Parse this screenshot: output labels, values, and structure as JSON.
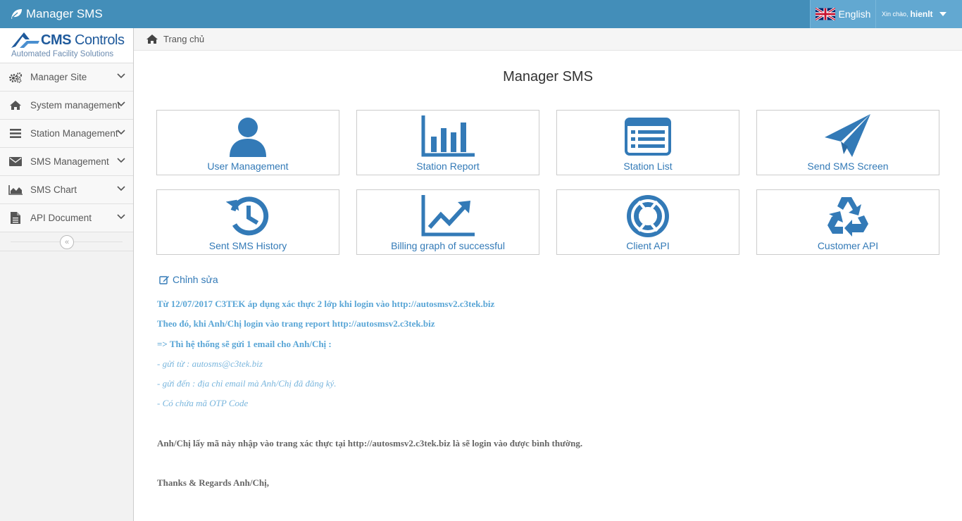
{
  "navbar": {
    "brand": "Manager SMS",
    "language": "English",
    "greeting": "Xin chào,",
    "username": "hienlt"
  },
  "sidebar": {
    "logo_name_bold": "CMS",
    "logo_name": "Controls",
    "logo_tagline": "Automated Facility Solutions",
    "items": [
      {
        "label": "Manager Site",
        "icon": "cogs-icon"
      },
      {
        "label": "System management",
        "icon": "home-icon"
      },
      {
        "label": "Station Management",
        "icon": "bars-icon"
      },
      {
        "label": "SMS Management",
        "icon": "envelope-icon"
      },
      {
        "label": "SMS Chart",
        "icon": "area-chart-icon"
      },
      {
        "label": "API Document",
        "icon": "file-icon"
      }
    ],
    "collapse_glyph": "«"
  },
  "breadcrumb": {
    "home": "Trang chủ"
  },
  "main": {
    "title": "Manager SMS",
    "tiles": [
      {
        "label": "User Management",
        "icon": "user-icon"
      },
      {
        "label": "Station Report",
        "icon": "bar-chart-icon"
      },
      {
        "label": "Station List",
        "icon": "list-alt-icon"
      },
      {
        "label": "Send SMS Screen",
        "icon": "paper-plane-icon"
      },
      {
        "label": "Sent SMS History",
        "icon": "history-icon"
      },
      {
        "label": "Billing graph of successful",
        "icon": "line-chart-icon"
      },
      {
        "label": "Client API",
        "icon": "life-ring-icon"
      },
      {
        "label": "Customer API",
        "icon": "recycle-icon"
      }
    ],
    "edit_label": "Chỉnh sửa",
    "notice": {
      "line1": "Từ 12/07/2017 C3TEK áp dụng xác thực 2 lớp khi login vào http://autosmsv2.c3tek.biz",
      "line2": "Theo đó, khi Anh/Chị login vào trang report http://autosmsv2.c3tek.biz",
      "line3": "=> Thì hệ thống sẽ gửi 1 email cho Anh/Chị :",
      "line4": "- gửi từ : autosms@c3tek.biz",
      "line5": "- gửi đến : địa chỉ email mà Anh/Chị đã đăng ký.",
      "line6": "- Có chứa mã OTP Code",
      "line7": "Anh/Chị lấy mã này nhập vào trang xác thực tại http://autosmsv2.c3tek.biz là sẽ login vào được bình thường.",
      "line8": "Thanks & Regards Anh/Chị,"
    }
  },
  "colors": {
    "navbar": "#438eb9",
    "accent": "#337ab7",
    "notice_blue": "#5aa6d6"
  }
}
